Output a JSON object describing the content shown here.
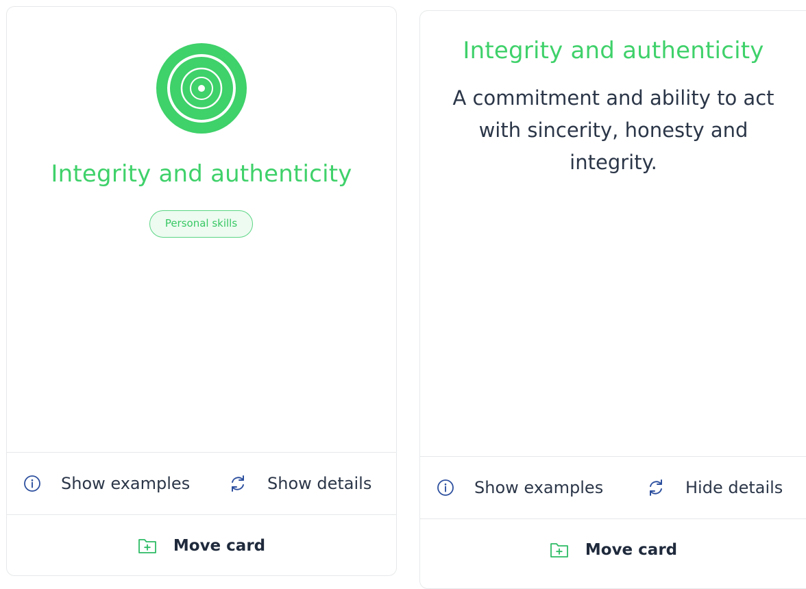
{
  "front": {
    "emblem_icon": "concentric-target-icon",
    "title": "Integrity and authenticity",
    "badge": "Personal skills",
    "show_examples": "Show examples",
    "toggle_details": "Show details",
    "move_card": "Move card"
  },
  "back": {
    "title": "Integrity and authenticity",
    "description": "A commitment and ability to act with sincerity, honesty and integrity.",
    "show_examples": "Show examples",
    "toggle_details": "Hide details",
    "move_card": "Move card"
  },
  "colors": {
    "accent_green": "#3fd16a",
    "text_dark": "#2b3648",
    "border": "#e6e8ea"
  }
}
